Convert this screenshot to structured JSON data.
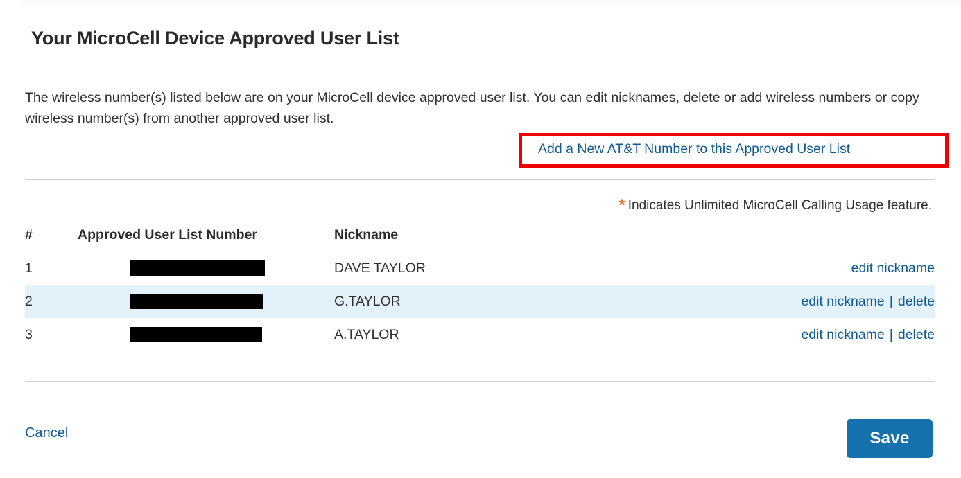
{
  "page": {
    "title": "Your MicroCell Device Approved User List",
    "intro": "The wireless number(s) listed below are on your MicroCell device approved user list. You can edit nicknames, delete or add wireless numbers or copy wireless number(s) from another approved user list."
  },
  "actions": {
    "add_number_link": "Add a New AT&T Number to this Approved User List",
    "cancel_label": "Cancel",
    "save_label": "Save"
  },
  "legend": {
    "symbol": "*",
    "text": "Indicates Unlimited MicroCell Calling Usage feature.",
    "symbol_color": "#e8762c"
  },
  "table": {
    "headers": {
      "index": "#",
      "number": "Approved User List Number",
      "nickname": "Nickname",
      "actions": ""
    },
    "rows": [
      {
        "index": "1",
        "number": "",
        "number_redacted": true,
        "nickname": "DAVE TAYLOR",
        "edit_label": "edit nickname",
        "delete_label": "",
        "separator": "",
        "highlighted": false
      },
      {
        "index": "2",
        "number": "",
        "number_redacted": true,
        "nickname": "G.TAYLOR",
        "edit_label": "edit nickname",
        "delete_label": "delete",
        "separator": "|",
        "highlighted": true
      },
      {
        "index": "3",
        "number": "",
        "number_redacted": true,
        "nickname": "A.TAYLOR",
        "edit_label": "edit nickname",
        "delete_label": "delete",
        "separator": "|",
        "highlighted": false
      }
    ]
  },
  "colors": {
    "link": "#0f5a94",
    "annotation_border": "#ee0000",
    "row_highlight": "#e3f2fa",
    "save_background": "#1572ac",
    "divider": "#cfcfcf"
  }
}
